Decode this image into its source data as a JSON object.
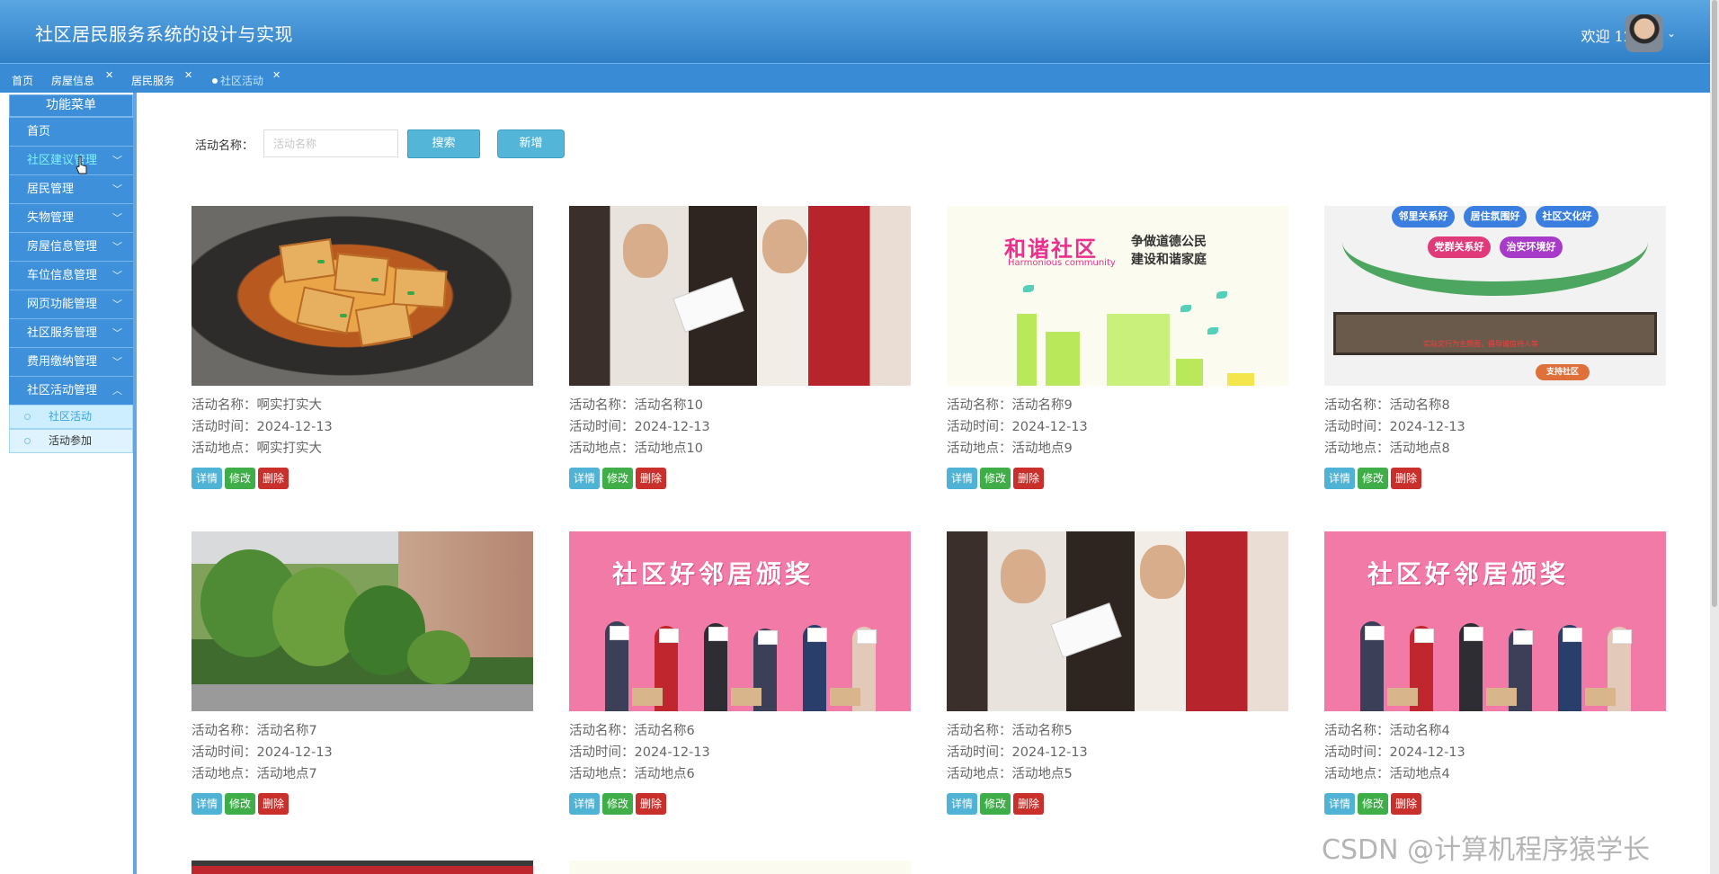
{
  "header": {
    "title": "社区居民服务系统的设计与实现",
    "welcome": "欢迎 12"
  },
  "tabs": [
    {
      "label": "首页",
      "closable": false
    },
    {
      "label": "房屋信息",
      "closable": true
    },
    {
      "label": "居民服务",
      "closable": true
    },
    {
      "label": "社区活动",
      "closable": true,
      "active": true
    }
  ],
  "sidebar": {
    "title": "功能菜单",
    "items": [
      {
        "label": "首页"
      },
      {
        "label": "社区建议管理"
      },
      {
        "label": "居民管理"
      },
      {
        "label": "失物管理"
      },
      {
        "label": "房屋信息管理"
      },
      {
        "label": "车位信息管理"
      },
      {
        "label": "网页功能管理"
      },
      {
        "label": "社区服务管理"
      },
      {
        "label": "费用缴纳管理"
      },
      {
        "label": "社区活动管理"
      }
    ],
    "sub_items": [
      {
        "label": "社区活动"
      },
      {
        "label": "活动参加"
      }
    ]
  },
  "search": {
    "label": "活动名称：",
    "placeholder": "活动名称",
    "search_button": "搜索",
    "add_button": "新增"
  },
  "card_labels": {
    "name": "活动名称：",
    "time": "活动时间：",
    "place": "活动地点："
  },
  "card_buttons": {
    "detail": "详情",
    "edit": "修改",
    "delete": "删除"
  },
  "cards": [
    {
      "name": "啊实打实大",
      "time": "2024-12-13",
      "place": "啊实打实大",
      "image": "tofu-dish"
    },
    {
      "name": "活动名称10",
      "time": "2024-12-13",
      "place": "活动地点10",
      "image": "volunteer-survey"
    },
    {
      "name": "活动名称9",
      "time": "2024-12-13",
      "place": "活动地点9",
      "image": "harmonious-community-poster"
    },
    {
      "name": "活动名称8",
      "time": "2024-12-13",
      "place": "活动地点8",
      "image": "community-culture-wall"
    },
    {
      "name": "活动名称7",
      "time": "2024-12-13",
      "place": "活动地点7",
      "image": "residential-garden"
    },
    {
      "name": "活动名称6",
      "time": "2024-12-13",
      "place": "活动地点6",
      "image": "good-neighbor-award"
    },
    {
      "name": "活动名称5",
      "time": "2024-12-13",
      "place": "活动地点5",
      "image": "volunteer-survey"
    },
    {
      "name": "活动名称4",
      "time": "2024-12-13",
      "place": "活动地点4",
      "image": "good-neighbor-award"
    }
  ],
  "images": {
    "harmony": {
      "title": "和谐社区",
      "sub": "Harmonious community",
      "line1": "争做道德公民",
      "line2": "建设和谐家庭"
    },
    "wall": {
      "pills": [
        "邻里关系好",
        "居住氛围好",
        "社区文化好",
        "党群关系好",
        "治安环境好"
      ],
      "board": "实际文行为主题图，倡导诚信待人等",
      "sign": "支持社区"
    },
    "award": {
      "title": "社区好邻居颁奖"
    }
  },
  "watermark": "CSDN @计算机程序猿学长",
  "colors": {
    "header": "#3a8bd6",
    "menu": "#3f90db",
    "detail": "#4fb3d6",
    "edit": "#3fae49",
    "delete": "#c9302c"
  }
}
